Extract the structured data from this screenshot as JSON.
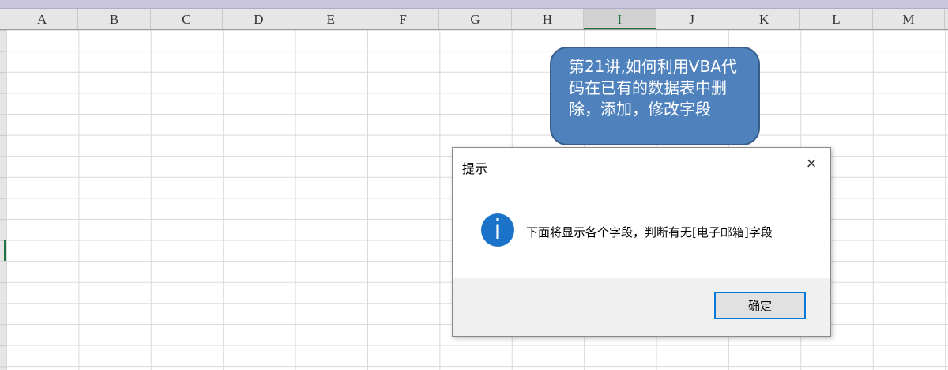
{
  "spreadsheet": {
    "columns": [
      "A",
      "B",
      "C",
      "D",
      "E",
      "F",
      "G",
      "H",
      "I",
      "J",
      "K",
      "L",
      "M"
    ],
    "selected_column": "I"
  },
  "callout": {
    "text": "第21讲,如何利用VBA代码在已有的数据表中删除，添加，修改字段"
  },
  "dialog": {
    "title": "提示",
    "close_icon": "×",
    "info_icon": "i",
    "message": "下面将显示各个字段，判断有无[电子邮箱]字段",
    "ok_label": "确定"
  }
}
